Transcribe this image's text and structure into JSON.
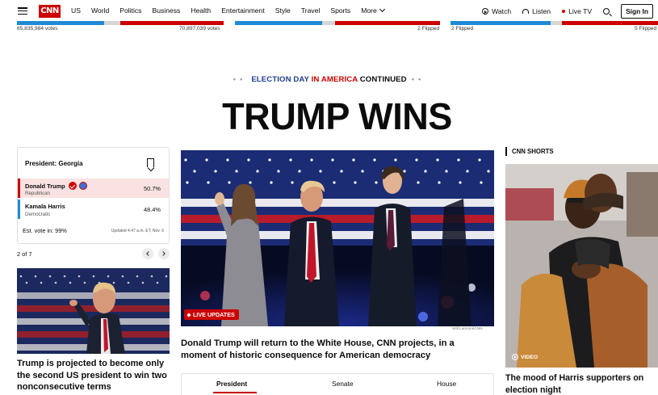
{
  "nav": {
    "logo": "CNN",
    "links": [
      "US",
      "World",
      "Politics",
      "Business",
      "Health",
      "Entertainment",
      "Style",
      "Travel",
      "Sports",
      "More"
    ],
    "watch": "Watch",
    "listen": "Listen",
    "live_tv": "Live TV",
    "sign_in": "Sign In"
  },
  "results_strip": {
    "left_votes": "65,835,984 votes",
    "right_votes": "70,897,039 votes",
    "flipped_1": "2 Flipped",
    "flipped_2": "2 Flipped",
    "flipped_3": "5 Flipped"
  },
  "kicker": {
    "part1": "ELECTION DAY",
    "part2": "IN AMERICA",
    "part3": "CONTINUED"
  },
  "headline": "TRUMP WINS",
  "race_card": {
    "title": "President: Georgia",
    "candidates": [
      {
        "name": "Donald Trump",
        "party": "Republican",
        "pct": "50.7%",
        "color": "#cc0000",
        "winner": true
      },
      {
        "name": "Kamala Harris",
        "party": "Democratic",
        "pct": "48.4%",
        "color": "#1f8ad6",
        "winner": false
      }
    ],
    "est_vote": "Est. vote in: 99%",
    "updated": "Updated 4:47 a.m. ET, Nov. 6"
  },
  "pager": {
    "label": "2 of 7"
  },
  "small_story": {
    "headline": "Trump is projected to become only the second US president to win two nonconsecutive terms"
  },
  "main_story": {
    "badge": "LIVE UPDATES",
    "credit": "Will Lanzoni/CNN",
    "headline": "Donald Trump will return to the White House, CNN projects, in a moment of historic consequence for American democracy"
  },
  "tabs": [
    "President",
    "Senate",
    "House"
  ],
  "shorts": {
    "label": "CNN SHORTS",
    "tag": "VIDEO",
    "headline": "The mood of Harris supporters on election night"
  },
  "colors": {
    "accent": "#cc0000",
    "dem": "#1f8ad6",
    "kicker_blue": "#1f3f8a"
  }
}
